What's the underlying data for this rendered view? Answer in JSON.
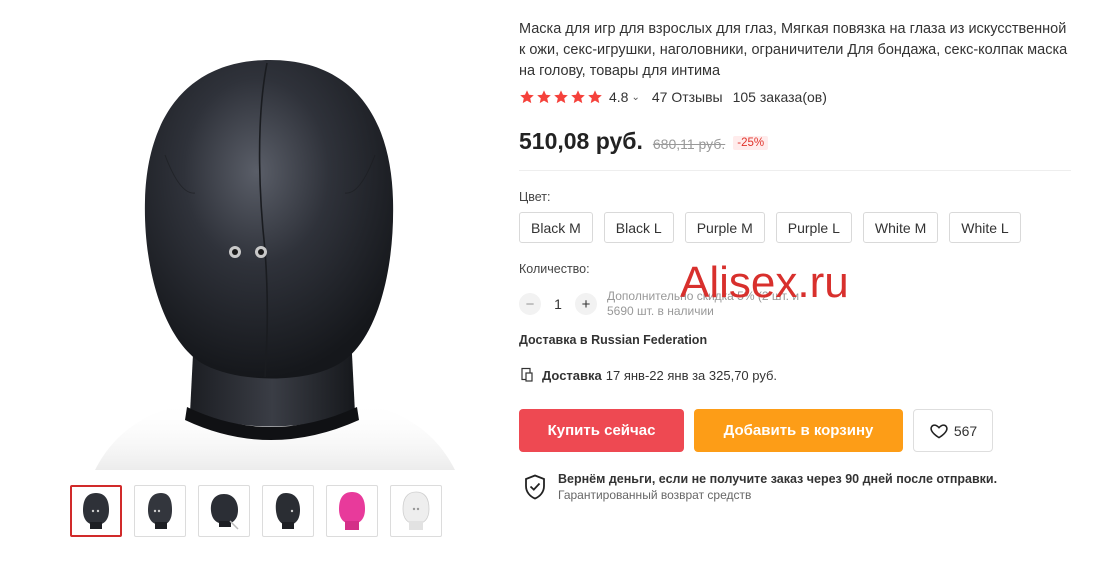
{
  "product": {
    "title": "Маска для игр для взрослых для глаз, Мягкая повязка на глаза из искусственной к ожи, секс-игрушки, наголовники, ограничители Для бондажа, секс-колпак маска на голову, товары для интима",
    "rating": "4.8",
    "stars": 5,
    "reviews": "47 Отзывы",
    "orders": "105 заказа(ов)",
    "price": "510,08 руб.",
    "old_price": "680,11 руб.",
    "discount": "-25%"
  },
  "color": {
    "label": "Цвет:",
    "options": [
      "Black M",
      "Black L",
      "Purple M",
      "Purple L",
      "White M",
      "White L"
    ]
  },
  "quantity": {
    "label": "Количество:",
    "minus": "−",
    "value": "1",
    "plus": "+",
    "note_line1": "Дополнительно скидка 5% (2 шт. и",
    "note_line2": "5690 шт. в наличии"
  },
  "watermark": "Alisex.ru",
  "shipping": {
    "to": "Доставка в Russian Federation",
    "delivery_label": "Доставка",
    "delivery_text": "17 янв-22 янв за 325,70 руб."
  },
  "actions": {
    "buy": "Купить сейчас",
    "cart": "Добавить в корзину",
    "wishlist_count": "567"
  },
  "guarantee": {
    "title": "Вернём деньги, если не получите заказ через 90 дней после отправки.",
    "subtitle": "Гарантированный возврат средств"
  },
  "colors": {
    "star": "#f5413b",
    "buy_button": "#ee4952",
    "cart_button": "#fd9d17",
    "discount": "#e0332b",
    "active_thumb_border": "#d12a2a"
  },
  "thumbnails": [
    "black-hood-front",
    "black-hood-three-quarter",
    "black-hood-side-zip",
    "black-hood-angle",
    "pink-hood",
    "white-hood"
  ]
}
